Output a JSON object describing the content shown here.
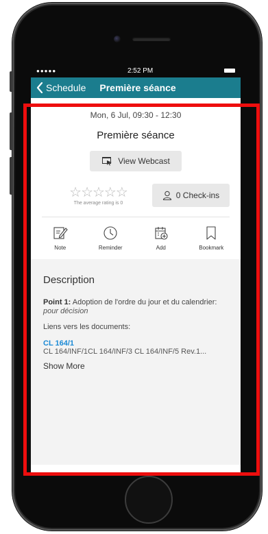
{
  "status_bar": {
    "signal": "●●●●●",
    "time": "2:52 PM"
  },
  "nav": {
    "back_label": "Schedule",
    "title": "Première séance"
  },
  "session": {
    "time": "Mon, 6 Jul, 09:30 - 12:30",
    "title": "Première séance",
    "webcast_label": "View Webcast"
  },
  "rating": {
    "stars": "☆☆☆☆☆",
    "caption": "The average rating is 0",
    "value": 0
  },
  "checkins": {
    "label": "0 Check-ins"
  },
  "actions": [
    {
      "label": "Note",
      "icon": "note-icon"
    },
    {
      "label": "Reminder",
      "icon": "clock-icon"
    },
    {
      "label": "Add",
      "icon": "calendar-add-icon"
    },
    {
      "label": "Bookmark",
      "icon": "bookmark-icon"
    }
  ],
  "description": {
    "heading": "Description",
    "point_label": "Point 1:",
    "point_text": " Adoption de l'ordre du jour et du calendrier:",
    "point_note": "pour décision",
    "links_label": "Liens vers les documents:",
    "doc_link": "CL 164/1",
    "doc_list": "CL 164/INF/1CL 164/INF/3   CL 164/INF/5 Rev.1...",
    "show_more": "Show More"
  },
  "colors": {
    "nav": "#1b7d8e",
    "link": "#1b8ad6",
    "highlight": "#ee0e0e"
  }
}
